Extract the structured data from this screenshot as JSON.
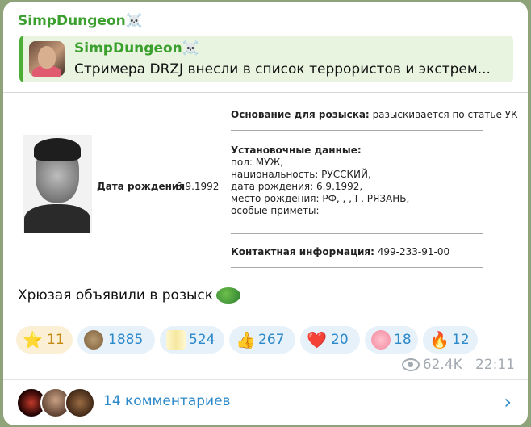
{
  "post": {
    "channel_name": "SimpDungeon",
    "channel_emoji": "☠️",
    "reply": {
      "title": "SimpDungeon",
      "title_emoji": "☠️",
      "text": "Стримера DRZJ внесли в список террористов и экстрем..."
    },
    "document": {
      "dob_label": "Дата рождения",
      "dob_value": "6.9.1992",
      "basis_label": "Основание для розыска:",
      "basis_value": "разыскивается по статье УК",
      "ident_label": "Установочные данные:",
      "ident_lines": [
        "пол: МУЖ,",
        "национальность: РУССКИЙ,",
        "дата рождения: 6.9.1992,",
        "место рождения: РФ, , , Г. РЯЗАНЬ,",
        "особые приметы:"
      ],
      "contact_label": "Контактная информация:",
      "contact_value": "499-233-91-00"
    },
    "message_text": "Хрюзая объявили в розыск",
    "reactions": [
      {
        "icon": "⭐",
        "count": "11"
      },
      {
        "icon": "bear-sticker",
        "count": "1885"
      },
      {
        "icon": "blurred-sticker",
        "count": "524"
      },
      {
        "icon": "👍",
        "count": "267"
      },
      {
        "icon": "❤️",
        "count": "20"
      },
      {
        "icon": "pig-sticker",
        "count": "18"
      },
      {
        "icon": "🔥",
        "count": "12"
      }
    ],
    "views": "62.4K",
    "time": "22:11",
    "comments_label": "14 комментариев"
  }
}
